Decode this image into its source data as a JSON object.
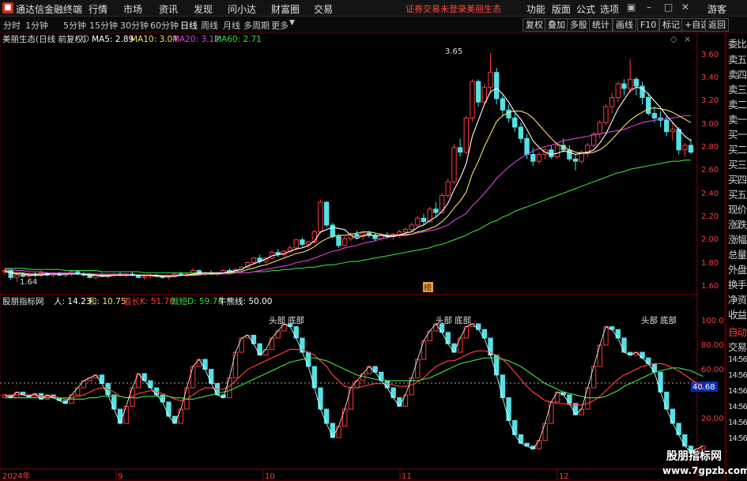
{
  "app": {
    "title": "通达信金融终端",
    "menu": [
      "行情",
      "市场",
      "资讯",
      "发现",
      "问小达",
      "财富圈",
      "交易"
    ],
    "promo": [
      "证券交易未登录",
      "美丽生态"
    ],
    "right_menu": [
      "功能",
      "版面",
      "公式",
      "选项",
      "游客"
    ]
  },
  "toolbar": {
    "periods": [
      "分时",
      "1分钟",
      "5分钟",
      "15分钟",
      "30分钟",
      "60分钟",
      "日线",
      "周线",
      "月线",
      "多周期",
      "更多"
    ],
    "active_period": "日线",
    "buttons": [
      "复权",
      "叠加",
      "多股",
      "统计",
      "画线",
      "F10",
      "标记",
      "+自选",
      "返回"
    ]
  },
  "main_header": {
    "title": "美丽生态(日线 前复权)",
    "indicators": [
      {
        "label": "MA5: 2.89",
        "color": "#ffffff"
      },
      {
        "label": "MA10: 3.04",
        "color": "#f2e36c"
      },
      {
        "label": "MA20: 3.12",
        "color": "#e040e0"
      },
      {
        "label": "MA60: 2.71",
        "color": "#3dd63d"
      }
    ]
  },
  "sub_header": {
    "title": "股朋指标网",
    "indicators": [
      {
        "label": "人: 14.23",
        "color": "#ffffff"
      },
      {
        "label": "和: 10.75",
        "color": "#f2e36c"
      },
      {
        "label": "看长K: 51.70",
        "color": "#ff3b3b"
      },
      {
        "label": "做短D: 59.73",
        "color": "#3dd63d"
      },
      {
        "label": "牛熊线: 50.00",
        "color": "#ffffff"
      }
    ]
  },
  "price_axis": [
    "3.60",
    "3.40",
    "3.20",
    "3.00",
    "2.80",
    "2.60",
    "2.40",
    "2.20",
    "2.00",
    "1.80",
    "1.60"
  ],
  "osc_axis": [
    "100.0",
    "80.00",
    "60.00",
    "40.68",
    "20.00"
  ],
  "osc_axis_right": [
    "14:56",
    "14:56",
    "14:56",
    "14:56",
    "14:56",
    "14:56",
    "14:56",
    "14:56",
    "14:56",
    "14:56"
  ],
  "current_value_badge": "40.68",
  "price_markers": {
    "high": "3.65",
    "low": "1.64",
    "tag": "榜"
  },
  "pattern_labels": [
    "头部",
    "底部",
    "头部",
    "底部",
    "头部",
    "底部"
  ],
  "dates": [
    "2024年",
    "9",
    "10",
    "11",
    "12"
  ],
  "right_panel": [
    "委比",
    "卖五",
    "卖四",
    "卖三",
    "卖二",
    "卖一",
    "买一",
    "买二",
    "买三",
    "买四",
    "买五",
    "现价",
    "涨跌",
    "涨幅",
    "总量",
    "外盘",
    "换手",
    "净资",
    "收益",
    "自动",
    "交易"
  ],
  "watermark": {
    "line1": "股朋指标网",
    "line2": "www.7gpzb.com"
  },
  "colors": {
    "up": "#ff3b3b",
    "down": "#54e1e6",
    "ma5": "#ffffff",
    "ma10": "#f2e36c",
    "ma20": "#e040e0",
    "ma60": "#3dd63d"
  },
  "chart_data": {
    "type": "candlestick",
    "ylim": [
      1.55,
      3.7
    ],
    "ohlc": [
      [
        1.73,
        1.76,
        1.7,
        1.74
      ],
      [
        1.74,
        1.75,
        1.66,
        1.68
      ],
      [
        1.68,
        1.71,
        1.64,
        1.7
      ],
      [
        1.7,
        1.72,
        1.68,
        1.69
      ],
      [
        1.69,
        1.72,
        1.67,
        1.71
      ],
      [
        1.71,
        1.73,
        1.68,
        1.7
      ],
      [
        1.7,
        1.74,
        1.68,
        1.72
      ],
      [
        1.72,
        1.73,
        1.69,
        1.7
      ],
      [
        1.7,
        1.72,
        1.68,
        1.71
      ],
      [
        1.71,
        1.73,
        1.69,
        1.7
      ],
      [
        1.7,
        1.72,
        1.68,
        1.71
      ],
      [
        1.71,
        1.74,
        1.69,
        1.73
      ],
      [
        1.73,
        1.74,
        1.7,
        1.71
      ],
      [
        1.71,
        1.73,
        1.69,
        1.7
      ],
      [
        1.7,
        1.72,
        1.67,
        1.68
      ],
      [
        1.68,
        1.71,
        1.66,
        1.7
      ],
      [
        1.7,
        1.72,
        1.68,
        1.69
      ],
      [
        1.69,
        1.71,
        1.67,
        1.7
      ],
      [
        1.7,
        1.72,
        1.68,
        1.71
      ],
      [
        1.71,
        1.73,
        1.69,
        1.7
      ],
      [
        1.7,
        1.72,
        1.68,
        1.71
      ],
      [
        1.71,
        1.73,
        1.69,
        1.7
      ],
      [
        1.7,
        1.71,
        1.67,
        1.68
      ],
      [
        1.68,
        1.7,
        1.66,
        1.69
      ],
      [
        1.69,
        1.71,
        1.67,
        1.7
      ],
      [
        1.7,
        1.71,
        1.68,
        1.69
      ],
      [
        1.69,
        1.7,
        1.67,
        1.68
      ],
      [
        1.68,
        1.7,
        1.66,
        1.69
      ],
      [
        1.69,
        1.72,
        1.68,
        1.71
      ],
      [
        1.71,
        1.73,
        1.69,
        1.7
      ],
      [
        1.7,
        1.72,
        1.68,
        1.71
      ],
      [
        1.71,
        1.76,
        1.7,
        1.74
      ],
      [
        1.74,
        1.75,
        1.7,
        1.71
      ],
      [
        1.71,
        1.73,
        1.69,
        1.72
      ],
      [
        1.72,
        1.74,
        1.7,
        1.71
      ],
      [
        1.71,
        1.73,
        1.69,
        1.72
      ],
      [
        1.72,
        1.75,
        1.71,
        1.74
      ],
      [
        1.74,
        1.76,
        1.72,
        1.73
      ],
      [
        1.73,
        1.76,
        1.72,
        1.75
      ],
      [
        1.75,
        1.78,
        1.73,
        1.77
      ],
      [
        1.77,
        1.82,
        1.76,
        1.81
      ],
      [
        1.81,
        1.86,
        1.79,
        1.85
      ],
      [
        1.85,
        1.88,
        1.8,
        1.82
      ],
      [
        1.82,
        1.86,
        1.8,
        1.85
      ],
      [
        1.85,
        1.92,
        1.84,
        1.9
      ],
      [
        1.9,
        1.93,
        1.86,
        1.88
      ],
      [
        1.88,
        1.92,
        1.86,
        1.91
      ],
      [
        1.91,
        1.96,
        1.89,
        1.94
      ],
      [
        1.94,
        2.02,
        1.92,
        2.01
      ],
      [
        2.01,
        2.03,
        1.95,
        1.97
      ],
      [
        1.97,
        2.0,
        1.94,
        1.99
      ],
      [
        1.99,
        2.1,
        1.98,
        2.08
      ],
      [
        2.08,
        2.36,
        2.06,
        2.34
      ],
      [
        2.34,
        2.35,
        2.12,
        2.14
      ],
      [
        2.14,
        2.16,
        2.02,
        2.04
      ],
      [
        2.04,
        2.06,
        1.94,
        1.96
      ],
      [
        1.96,
        2.04,
        1.95,
        2.02
      ],
      [
        2.02,
        2.08,
        2.0,
        2.06
      ],
      [
        2.06,
        2.09,
        2.02,
        2.04
      ],
      [
        2.04,
        2.08,
        2.01,
        2.07
      ],
      [
        2.07,
        2.09,
        2.03,
        2.05
      ],
      [
        2.05,
        2.07,
        2.0,
        2.02
      ],
      [
        2.02,
        2.06,
        2.0,
        2.05
      ],
      [
        2.05,
        2.08,
        2.02,
        2.04
      ],
      [
        2.04,
        2.07,
        2.01,
        2.06
      ],
      [
        2.06,
        2.1,
        2.03,
        2.08
      ],
      [
        2.08,
        2.12,
        2.05,
        2.1
      ],
      [
        2.1,
        2.16,
        2.08,
        2.14
      ],
      [
        2.14,
        2.22,
        2.12,
        2.2
      ],
      [
        2.2,
        2.24,
        2.14,
        2.17
      ],
      [
        2.17,
        2.3,
        2.16,
        2.28
      ],
      [
        2.28,
        2.34,
        2.22,
        2.25
      ],
      [
        2.25,
        2.42,
        2.24,
        2.4
      ],
      [
        2.4,
        2.55,
        2.38,
        2.52
      ],
      [
        2.52,
        2.85,
        2.5,
        2.82
      ],
      [
        2.82,
        2.9,
        2.74,
        2.78
      ],
      [
        2.78,
        3.1,
        2.76,
        3.08
      ],
      [
        3.08,
        3.42,
        3.05,
        3.4
      ],
      [
        3.4,
        3.42,
        3.18,
        3.22
      ],
      [
        3.22,
        3.38,
        3.2,
        3.35
      ],
      [
        3.35,
        3.65,
        3.3,
        3.48
      ],
      [
        3.48,
        3.52,
        3.2,
        3.25
      ],
      [
        3.25,
        3.28,
        3.1,
        3.15
      ],
      [
        3.15,
        3.2,
        3.04,
        3.08
      ],
      [
        3.08,
        3.12,
        2.96,
        3.0
      ],
      [
        3.0,
        3.04,
        2.86,
        2.9
      ],
      [
        2.9,
        2.94,
        2.72,
        2.76
      ],
      [
        2.76,
        2.82,
        2.66,
        2.7
      ],
      [
        2.7,
        2.78,
        2.68,
        2.76
      ],
      [
        2.76,
        2.82,
        2.72,
        2.8
      ],
      [
        2.8,
        2.84,
        2.72,
        2.74
      ],
      [
        2.74,
        2.86,
        2.72,
        2.84
      ],
      [
        2.84,
        2.9,
        2.78,
        2.8
      ],
      [
        2.8,
        2.84,
        2.7,
        2.72
      ],
      [
        2.72,
        2.76,
        2.62,
        2.7
      ],
      [
        2.7,
        2.8,
        2.68,
        2.78
      ],
      [
        2.78,
        2.86,
        2.74,
        2.84
      ],
      [
        2.84,
        2.96,
        2.82,
        2.94
      ],
      [
        2.94,
        3.06,
        2.9,
        3.04
      ],
      [
        3.04,
        3.2,
        3.02,
        3.18
      ],
      [
        3.18,
        3.3,
        3.12,
        3.26
      ],
      [
        3.26,
        3.4,
        3.22,
        3.38
      ],
      [
        3.38,
        3.42,
        3.28,
        3.34
      ],
      [
        3.34,
        3.6,
        3.3,
        3.42
      ],
      [
        3.42,
        3.44,
        3.28,
        3.36
      ],
      [
        3.36,
        3.4,
        3.2,
        3.26
      ],
      [
        3.26,
        3.3,
        3.1,
        3.12
      ],
      [
        3.12,
        3.18,
        3.04,
        3.08
      ],
      [
        3.08,
        3.14,
        3.0,
        3.06
      ],
      [
        3.06,
        3.1,
        2.92,
        2.96
      ],
      [
        2.96,
        3.04,
        2.88,
        2.98
      ],
      [
        2.98,
        3.0,
        2.76,
        2.8
      ],
      [
        2.8,
        2.86,
        2.74,
        2.84
      ],
      [
        2.84,
        2.9,
        2.76,
        2.78
      ]
    ],
    "ma5": [
      1.73,
      1.72,
      1.71,
      1.71,
      1.7,
      1.7,
      1.7,
      1.71,
      1.71,
      1.71,
      1.71,
      1.71,
      1.71,
      1.71,
      1.7,
      1.7,
      1.69,
      1.69,
      1.7,
      1.7,
      1.7,
      1.7,
      1.7,
      1.7,
      1.7,
      1.69,
      1.69,
      1.69,
      1.69,
      1.7,
      1.7,
      1.71,
      1.72,
      1.72,
      1.72,
      1.72,
      1.72,
      1.73,
      1.74,
      1.75,
      1.78,
      1.8,
      1.82,
      1.84,
      1.87,
      1.88,
      1.89,
      1.91,
      1.93,
      1.94,
      1.96,
      2.0,
      2.08,
      2.1,
      2.12,
      2.11,
      2.1,
      2.05,
      2.02,
      2.05,
      2.05,
      2.05,
      2.05,
      2.04,
      2.04,
      2.05,
      2.07,
      2.08,
      2.12,
      2.14,
      2.18,
      2.21,
      2.26,
      2.33,
      2.45,
      2.55,
      2.68,
      2.92,
      3.06,
      3.2,
      3.31,
      3.34,
      3.29,
      3.22,
      3.13,
      3.07,
      2.98,
      2.88,
      2.82,
      2.78,
      2.76,
      2.77,
      2.79,
      2.78,
      2.76,
      2.77,
      2.78,
      2.8,
      2.86,
      2.94,
      3.05,
      3.16,
      3.24,
      3.32,
      3.35,
      3.34,
      3.29,
      3.23,
      3.17,
      3.1,
      3.04,
      2.98,
      2.92,
      2.88
    ],
    "ma10": [
      1.74,
      1.73,
      1.72,
      1.72,
      1.71,
      1.71,
      1.71,
      1.71,
      1.71,
      1.71,
      1.71,
      1.71,
      1.71,
      1.71,
      1.71,
      1.7,
      1.7,
      1.7,
      1.7,
      1.7,
      1.7,
      1.7,
      1.7,
      1.7,
      1.7,
      1.7,
      1.69,
      1.69,
      1.69,
      1.7,
      1.7,
      1.7,
      1.71,
      1.71,
      1.71,
      1.71,
      1.72,
      1.72,
      1.73,
      1.73,
      1.75,
      1.76,
      1.78,
      1.79,
      1.81,
      1.83,
      1.85,
      1.87,
      1.89,
      1.9,
      1.92,
      1.95,
      1.99,
      2.02,
      2.04,
      2.05,
      2.05,
      2.06,
      2.07,
      2.08,
      2.08,
      2.07,
      2.06,
      2.05,
      2.05,
      2.05,
      2.05,
      2.06,
      2.08,
      2.09,
      2.11,
      2.13,
      2.17,
      2.22,
      2.29,
      2.35,
      2.43,
      2.59,
      2.7,
      2.83,
      2.94,
      3.05,
      3.1,
      3.13,
      3.14,
      3.14,
      3.12,
      3.08,
      3.02,
      2.96,
      2.9,
      2.85,
      2.83,
      2.8,
      2.78,
      2.77,
      2.77,
      2.78,
      2.8,
      2.84,
      2.89,
      2.95,
      3.01,
      3.06,
      3.1,
      3.13,
      3.16,
      3.17,
      3.16,
      3.15,
      3.13,
      3.1,
      3.07,
      3.04
    ],
    "ma20": [
      1.75,
      1.75,
      1.74,
      1.74,
      1.73,
      1.73,
      1.73,
      1.72,
      1.72,
      1.72,
      1.72,
      1.72,
      1.71,
      1.71,
      1.71,
      1.71,
      1.71,
      1.71,
      1.71,
      1.71,
      1.71,
      1.7,
      1.7,
      1.7,
      1.7,
      1.7,
      1.7,
      1.7,
      1.7,
      1.7,
      1.7,
      1.7,
      1.7,
      1.71,
      1.71,
      1.71,
      1.71,
      1.71,
      1.72,
      1.72,
      1.72,
      1.73,
      1.74,
      1.75,
      1.76,
      1.77,
      1.78,
      1.79,
      1.81,
      1.82,
      1.83,
      1.85,
      1.87,
      1.89,
      1.91,
      1.92,
      1.94,
      1.95,
      1.96,
      1.98,
      1.99,
      2.0,
      2.02,
      2.03,
      2.04,
      2.05,
      2.06,
      2.06,
      2.07,
      2.08,
      2.09,
      2.1,
      2.12,
      2.14,
      2.18,
      2.21,
      2.24,
      2.31,
      2.36,
      2.42,
      2.48,
      2.55,
      2.6,
      2.65,
      2.69,
      2.73,
      2.76,
      2.79,
      2.81,
      2.83,
      2.84,
      2.86,
      2.88,
      2.89,
      2.9,
      2.91,
      2.92,
      2.93,
      2.94,
      2.95,
      2.96,
      2.97,
      2.98,
      3.0,
      3.02,
      3.04,
      3.05,
      3.06,
      3.07,
      3.07,
      3.08,
      3.09,
      3.1,
      3.1
    ],
    "ma60": [
      1.76,
      1.76,
      1.76,
      1.76,
      1.75,
      1.75,
      1.75,
      1.75,
      1.75,
      1.75,
      1.74,
      1.74,
      1.74,
      1.74,
      1.74,
      1.74,
      1.73,
      1.73,
      1.73,
      1.73,
      1.73,
      1.73,
      1.73,
      1.72,
      1.72,
      1.72,
      1.72,
      1.72,
      1.72,
      1.72,
      1.72,
      1.72,
      1.72,
      1.72,
      1.72,
      1.72,
      1.72,
      1.72,
      1.72,
      1.72,
      1.72,
      1.73,
      1.73,
      1.73,
      1.74,
      1.74,
      1.75,
      1.75,
      1.76,
      1.76,
      1.77,
      1.77,
      1.78,
      1.79,
      1.79,
      1.8,
      1.81,
      1.82,
      1.82,
      1.83,
      1.84,
      1.85,
      1.86,
      1.87,
      1.88,
      1.89,
      1.9,
      1.91,
      1.92,
      1.93,
      1.94,
      1.96,
      1.97,
      1.99,
      2.01,
      2.03,
      2.05,
      2.08,
      2.1,
      2.13,
      2.16,
      2.18,
      2.21,
      2.23,
      2.26,
      2.28,
      2.3,
      2.32,
      2.34,
      2.36,
      2.38,
      2.4,
      2.42,
      2.44,
      2.46,
      2.48,
      2.5,
      2.52,
      2.54,
      2.56,
      2.58,
      2.6,
      2.61,
      2.63,
      2.64,
      2.65,
      2.66,
      2.67,
      2.68,
      2.69,
      2.7,
      2.7,
      2.71,
      2.71
    ],
    "osc_ylim": [
      0,
      110
    ],
    "osc_bar_levels": [
      50,
      48,
      52,
      50,
      49,
      51,
      47,
      50,
      48,
      46,
      44,
      50,
      55,
      60,
      62,
      64,
      58,
      50,
      40,
      30,
      42,
      55,
      65,
      60,
      55,
      50,
      45,
      35,
      30,
      40,
      55,
      70,
      75,
      68,
      58,
      50,
      48,
      62,
      80,
      90,
      92,
      86,
      78,
      82,
      90,
      95,
      100,
      98,
      90,
      80,
      70,
      55,
      40,
      30,
      20,
      28,
      40,
      55,
      60,
      65,
      70,
      66,
      60,
      55,
      48,
      42,
      50,
      62,
      75,
      88,
      95,
      100,
      94,
      86,
      80,
      90,
      98,
      100,
      96,
      90,
      78,
      64,
      48,
      32,
      22,
      16,
      14,
      12,
      18,
      30,
      45,
      52,
      50,
      44,
      36,
      40,
      55,
      70,
      85,
      98,
      96,
      90,
      80,
      78,
      80,
      76,
      72,
      66,
      52,
      40,
      30,
      22,
      14,
      10,
      12,
      14
    ],
    "osc_k_line": [
      50,
      50,
      50,
      50,
      50,
      50,
      49,
      49,
      49,
      48,
      48,
      48,
      49,
      50,
      52,
      54,
      55,
      54,
      52,
      49,
      48,
      49,
      51,
      52,
      53,
      52,
      51,
      49,
      47,
      46,
      47,
      50,
      53,
      55,
      55,
      54,
      54,
      56,
      60,
      64,
      68,
      70,
      72,
      74,
      76,
      78,
      80,
      82,
      82,
      82,
      80,
      78,
      74,
      70,
      64,
      60,
      56,
      55,
      55,
      56,
      57,
      58,
      58,
      58,
      57,
      56,
      56,
      57,
      59,
      62,
      66,
      70,
      72,
      74,
      74,
      76,
      78,
      80,
      81,
      81,
      80,
      78,
      75,
      71,
      66,
      61,
      56,
      52,
      49,
      46,
      45,
      44,
      44,
      43,
      43,
      43,
      44,
      46,
      49,
      53,
      57,
      61,
      64,
      66,
      68,
      70,
      71,
      72,
      72,
      71,
      69,
      67,
      64,
      61,
      58,
      55
    ],
    "osc_d_line": [
      48,
      48,
      48,
      48,
      48,
      48,
      48,
      48,
      48,
      48,
      47,
      47,
      47,
      47,
      48,
      48,
      49,
      49,
      49,
      49,
      48,
      48,
      48,
      49,
      49,
      49,
      49,
      49,
      48,
      48,
      47,
      47,
      48,
      49,
      50,
      51,
      52,
      53,
      55,
      57,
      59,
      61,
      63,
      65,
      67,
      69,
      71,
      73,
      74,
      75,
      76,
      76,
      75,
      74,
      72,
      70,
      68,
      66,
      64,
      63,
      62,
      61,
      61,
      60,
      60,
      60,
      60,
      60,
      60,
      61,
      62,
      64,
      66,
      68,
      70,
      72,
      73,
      74,
      75,
      76,
      76,
      76,
      75,
      74,
      72,
      70,
      67,
      64,
      61,
      58,
      56,
      54,
      52,
      51,
      50,
      49,
      48,
      48,
      48,
      49,
      51,
      53,
      56,
      58,
      60,
      62,
      64,
      66,
      67,
      68,
      69,
      69,
      68,
      67,
      65,
      63
    ]
  }
}
